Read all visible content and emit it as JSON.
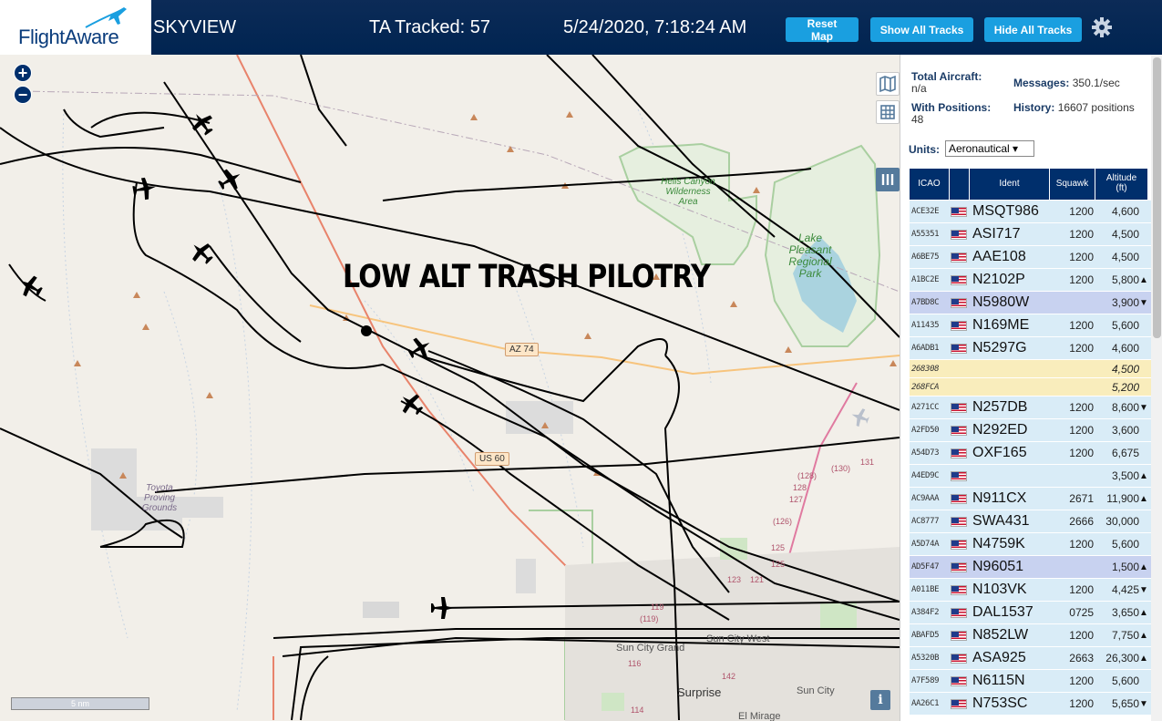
{
  "header": {
    "logo_text": "FlightAware",
    "app_name": "SKYVIEW",
    "tracked": "TA Tracked: 57",
    "datetime": "5/24/2020, 7:18:24 AM",
    "reset_map": "Reset Map",
    "show_all": "Show All Tracks",
    "hide_all": "Hide All Tracks"
  },
  "map": {
    "overlay_title": "LOW ALT TRASH PILOTRY",
    "zoom_in": "+",
    "zoom_out": "−",
    "scale": "5 nm",
    "info": "i",
    "labels": {
      "az74": "AZ 74",
      "us60": "US 60",
      "hells_canyon": "Hells Canyon Wilderness Area",
      "lake_pleasant": "Lake Pleasant Regional Park",
      "toyota": "Toyota Proving Grounds",
      "sun_city_grand": "Sun City Grand",
      "sun_city_west": "Sun City West",
      "surprise": "Surprise",
      "sun_city": "Sun City",
      "el_mirage": "El Mirage",
      "r128a": "(128)",
      "r128b": "128",
      "r127": "127",
      "r126": "(126)",
      "r125a": "125",
      "r125b": "125",
      "r130": "(130)",
      "r131": "131",
      "r123": "123",
      "r121": "121",
      "r119a": "119",
      "r119b": "(119)",
      "r116": "116",
      "r142": "142",
      "r114": "114"
    }
  },
  "stats": {
    "total_label": "Total Aircraft:",
    "total_value": "n/a",
    "positions_label": "With Positions:",
    "positions_value": "48",
    "messages_label": "Messages:",
    "messages_value": "350.1/sec",
    "history_label": "History:",
    "history_value": "16607 positions",
    "units_label": "Units:",
    "units_value": "Aeronautical ▾"
  },
  "table": {
    "headers": {
      "icao": "ICAO",
      "ident": "Ident",
      "squawk": "Squawk",
      "alt1": "Altitude",
      "alt2": "(ft)"
    },
    "rows": [
      {
        "icao": "ACE32E",
        "ident": "MSQT986",
        "squawk": "1200",
        "alt": "4,600",
        "trend": "",
        "state": "pos"
      },
      {
        "icao": "A55351",
        "ident": "ASI717",
        "squawk": "1200",
        "alt": "4,500",
        "trend": "",
        "state": "pos"
      },
      {
        "icao": "A6BE75",
        "ident": "AAE108",
        "squawk": "1200",
        "alt": "4,500",
        "trend": "",
        "state": "pos"
      },
      {
        "icao": "A1BC2E",
        "ident": "N2102P",
        "squawk": "1200",
        "alt": "5,800",
        "trend": "▲",
        "state": "pos"
      },
      {
        "icao": "A7BD8C",
        "ident": "N5980W",
        "squawk": "",
        "alt": "3,900",
        "trend": "▼",
        "state": "sel"
      },
      {
        "icao": "A11435",
        "ident": "N169ME",
        "squawk": "1200",
        "alt": "5,600",
        "trend": "",
        "state": "pos"
      },
      {
        "icao": "A6ADB1",
        "ident": "N5297G",
        "squawk": "1200",
        "alt": "4,600",
        "trend": "",
        "state": "pos"
      },
      {
        "icao": "268308",
        "ident": "",
        "squawk": "",
        "alt": "4,500",
        "trend": "",
        "state": "nopos"
      },
      {
        "icao": "268FCA",
        "ident": "",
        "squawk": "",
        "alt": "5,200",
        "trend": "",
        "state": "nopos"
      },
      {
        "icao": "A271CC",
        "ident": "N257DB",
        "squawk": "1200",
        "alt": "8,600",
        "trend": "▼",
        "state": "pos"
      },
      {
        "icao": "A2FD50",
        "ident": "N292ED",
        "squawk": "1200",
        "alt": "3,600",
        "trend": "",
        "state": "pos"
      },
      {
        "icao": "A54D73",
        "ident": "OXF165",
        "squawk": "1200",
        "alt": "6,675",
        "trend": "",
        "state": "pos"
      },
      {
        "icao": "A4ED9C",
        "ident": "",
        "squawk": "",
        "alt": "3,500",
        "trend": "▲",
        "state": "pos"
      },
      {
        "icao": "AC9AAA",
        "ident": "N911CX",
        "squawk": "2671",
        "alt": "11,900",
        "trend": "▲",
        "state": "pos"
      },
      {
        "icao": "AC8777",
        "ident": "SWA431",
        "squawk": "2666",
        "alt": "30,000",
        "trend": "",
        "state": "pos"
      },
      {
        "icao": "A5D74A",
        "ident": "N4759K",
        "squawk": "1200",
        "alt": "5,600",
        "trend": "",
        "state": "pos"
      },
      {
        "icao": "AD5F47",
        "ident": "N96051",
        "squawk": "",
        "alt": "1,500",
        "trend": "▲",
        "state": "sel"
      },
      {
        "icao": "A011BE",
        "ident": "N103VK",
        "squawk": "1200",
        "alt": "4,425",
        "trend": "▼",
        "state": "pos"
      },
      {
        "icao": "A384F2",
        "ident": "DAL1537",
        "squawk": "0725",
        "alt": "3,650",
        "trend": "▲",
        "state": "pos"
      },
      {
        "icao": "ABAFD5",
        "ident": "N852LW",
        "squawk": "1200",
        "alt": "7,750",
        "trend": "▲",
        "state": "pos"
      },
      {
        "icao": "A5320B",
        "ident": "ASA925",
        "squawk": "2663",
        "alt": "26,300",
        "trend": "▲",
        "state": "pos"
      },
      {
        "icao": "A7F589",
        "ident": "N6115N",
        "squawk": "1200",
        "alt": "5,600",
        "trend": "",
        "state": "pos"
      },
      {
        "icao": "AA26C1",
        "ident": "N753SC",
        "squawk": "1200",
        "alt": "5,650",
        "trend": "▼",
        "state": "pos"
      }
    ]
  },
  "colors": {
    "header_bg": "#002451",
    "button_blue": "#1a9fe0",
    "table_header": "#002f6c",
    "row_pos": "#d9ecf7",
    "row_selected": "#c8d2f0",
    "row_nopos": "#f9edbc",
    "park_green": "#8fc58f",
    "lake_blue": "#aad3df"
  },
  "icons": {
    "gear": "gear-icon",
    "layers": "map-layers-icon",
    "grid": "grid-icon",
    "columns": "columns-icon",
    "plane": "airplane-icon",
    "flag": "us-flag-icon"
  }
}
